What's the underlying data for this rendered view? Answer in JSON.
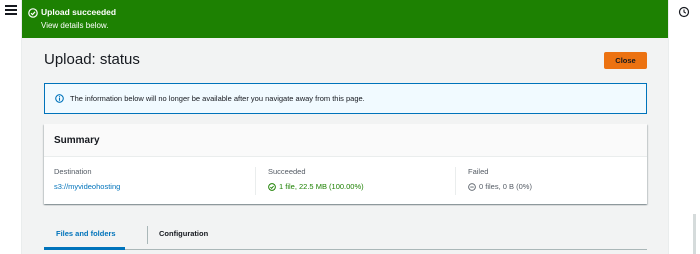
{
  "flash": {
    "title": "Upload succeeded",
    "link": "View details below."
  },
  "page": {
    "title": "Upload: status",
    "close_label": "Close"
  },
  "alert": {
    "text": "The information below will no longer be available after you navigate away from this page."
  },
  "summary": {
    "title": "Summary",
    "destination": {
      "label": "Destination",
      "value": "s3://myvideohosting"
    },
    "succeeded": {
      "label": "Succeeded",
      "value": "1 file, 22.5 MB (100.00%)"
    },
    "failed": {
      "label": "Failed",
      "value": "0 files, 0 B (0%)"
    }
  },
  "tabs": [
    {
      "label": "Files and folders"
    },
    {
      "label": "Configuration"
    }
  ],
  "icons": {
    "menu": "hamburger-icon",
    "right_rail": "settings-clock-icon",
    "flash": "check-circle-icon",
    "info": "info-icon",
    "success": "check-circle-icon",
    "failed": "minus-circle-icon"
  },
  "colors": {
    "success_green": "#1d8102",
    "accent_orange": "#ec7211",
    "link_blue": "#0073bb",
    "info_bg": "#f1faff"
  }
}
